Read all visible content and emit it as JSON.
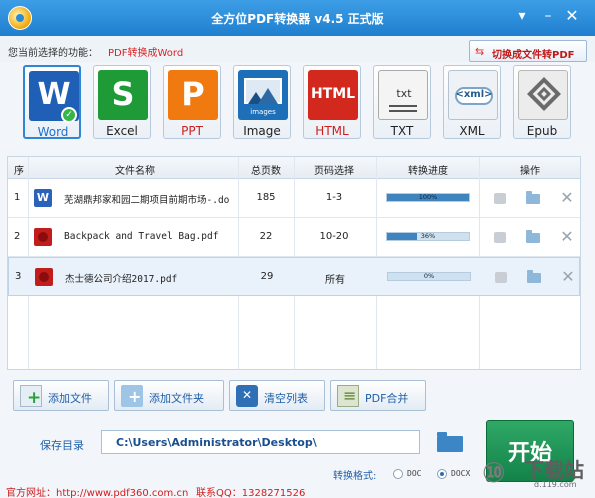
{
  "window": {
    "title": "全方位PDF转换器 v4.5 正式版",
    "menu_icon": "chevron-menu-icon",
    "min_icon": "minimize-icon",
    "close_icon": "close-icon"
  },
  "function_bar": {
    "label": "您当前选择的功能：",
    "value": "PDF转换成Word",
    "switch_label": "切换成文件转PDF",
    "switch_icon": "swap-arrows-icon"
  },
  "formats": [
    {
      "label": "Word",
      "glyph": "W",
      "color": "#1f5fb6",
      "icon": "word-icon",
      "active": true
    },
    {
      "label": "Excel",
      "glyph": "S",
      "color": "#1e9a36",
      "icon": "excel-icon",
      "active": false
    },
    {
      "label": "PPT",
      "glyph": "P",
      "color": "#f07a10",
      "icon": "ppt-icon",
      "active": false
    },
    {
      "label": "Image",
      "glyph": "images",
      "color": "#2b7fc4",
      "icon": "image-icon",
      "active": false
    },
    {
      "label": "HTML",
      "glyph": "HTML",
      "color": "#d2281e",
      "icon": "html-icon",
      "active": false
    },
    {
      "label": "TXT",
      "glyph": "txt",
      "color": "#e9e9e9",
      "icon": "txt-icon",
      "active": false
    },
    {
      "label": "XML",
      "glyph": "<xml>",
      "color": "#e6ecf2",
      "icon": "xml-icon",
      "active": false
    },
    {
      "label": "Epub",
      "glyph": "◆",
      "color": "#e6e6e6",
      "icon": "epub-icon",
      "active": false
    }
  ],
  "table": {
    "headers": {
      "idx": "序",
      "name": "文件名称",
      "pages": "总页数",
      "range": "页码选择",
      "progress": "转换进度",
      "actions": "操作"
    },
    "rows": [
      {
        "idx": "1",
        "type": "word",
        "name": "芜湖鼎邦家和园二期项目前期市场-.do",
        "pages": "185",
        "range": "1-3",
        "progress_text": "100%",
        "progress": 1.0
      },
      {
        "idx": "2",
        "type": "pdf",
        "name": "Backpack and Travel Bag.pdf",
        "pages": "22",
        "range": "10-20",
        "progress_text": "36%",
        "progress": 0.36
      },
      {
        "idx": "3",
        "type": "pdf",
        "name": "杰士德公司介绍2017.pdf",
        "pages": "29",
        "range": "所有",
        "progress_text": "0%",
        "progress": 0.0
      }
    ]
  },
  "buttons": {
    "add_file": "添加文件",
    "add_folder": "添加文件夹",
    "clear_list": "清空列表",
    "pdf_merge": "PDF合并"
  },
  "save": {
    "label": "保存目录",
    "value": "C:\\Users\\Administrator\\Desktop\\"
  },
  "start": {
    "label": "开始"
  },
  "output_format": {
    "label": "转换格式:",
    "options": [
      "DOC",
      "DOCX"
    ],
    "selected": "DOCX"
  },
  "footer": {
    "site": "官方网址：http://www.pdf360.com.cn",
    "qq": "联系QQ：1328271526"
  },
  "watermark": {
    "text": "下载站",
    "sub": "d.119.com"
  }
}
